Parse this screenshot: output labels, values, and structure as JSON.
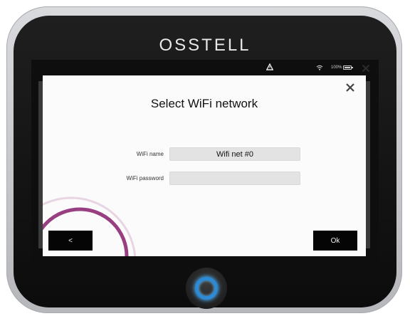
{
  "device": {
    "brand": "OSSTELL",
    "colors": {
      "home_ring": "#2d8bd6",
      "accent_arc": "#8e2a73"
    }
  },
  "statusbar": {
    "battery_text": "100%",
    "icons": [
      "warning-icon",
      "wifi-icon",
      "battery-icon",
      "close-icon"
    ]
  },
  "dialog": {
    "title": "Select WiFi network",
    "close_icon": "close-icon",
    "fields": [
      {
        "label": "WiFi name",
        "value": "Wifi net #0"
      },
      {
        "label": "WiFi password",
        "value": ""
      }
    ],
    "back_button": "<",
    "ok_button": "Ok"
  }
}
